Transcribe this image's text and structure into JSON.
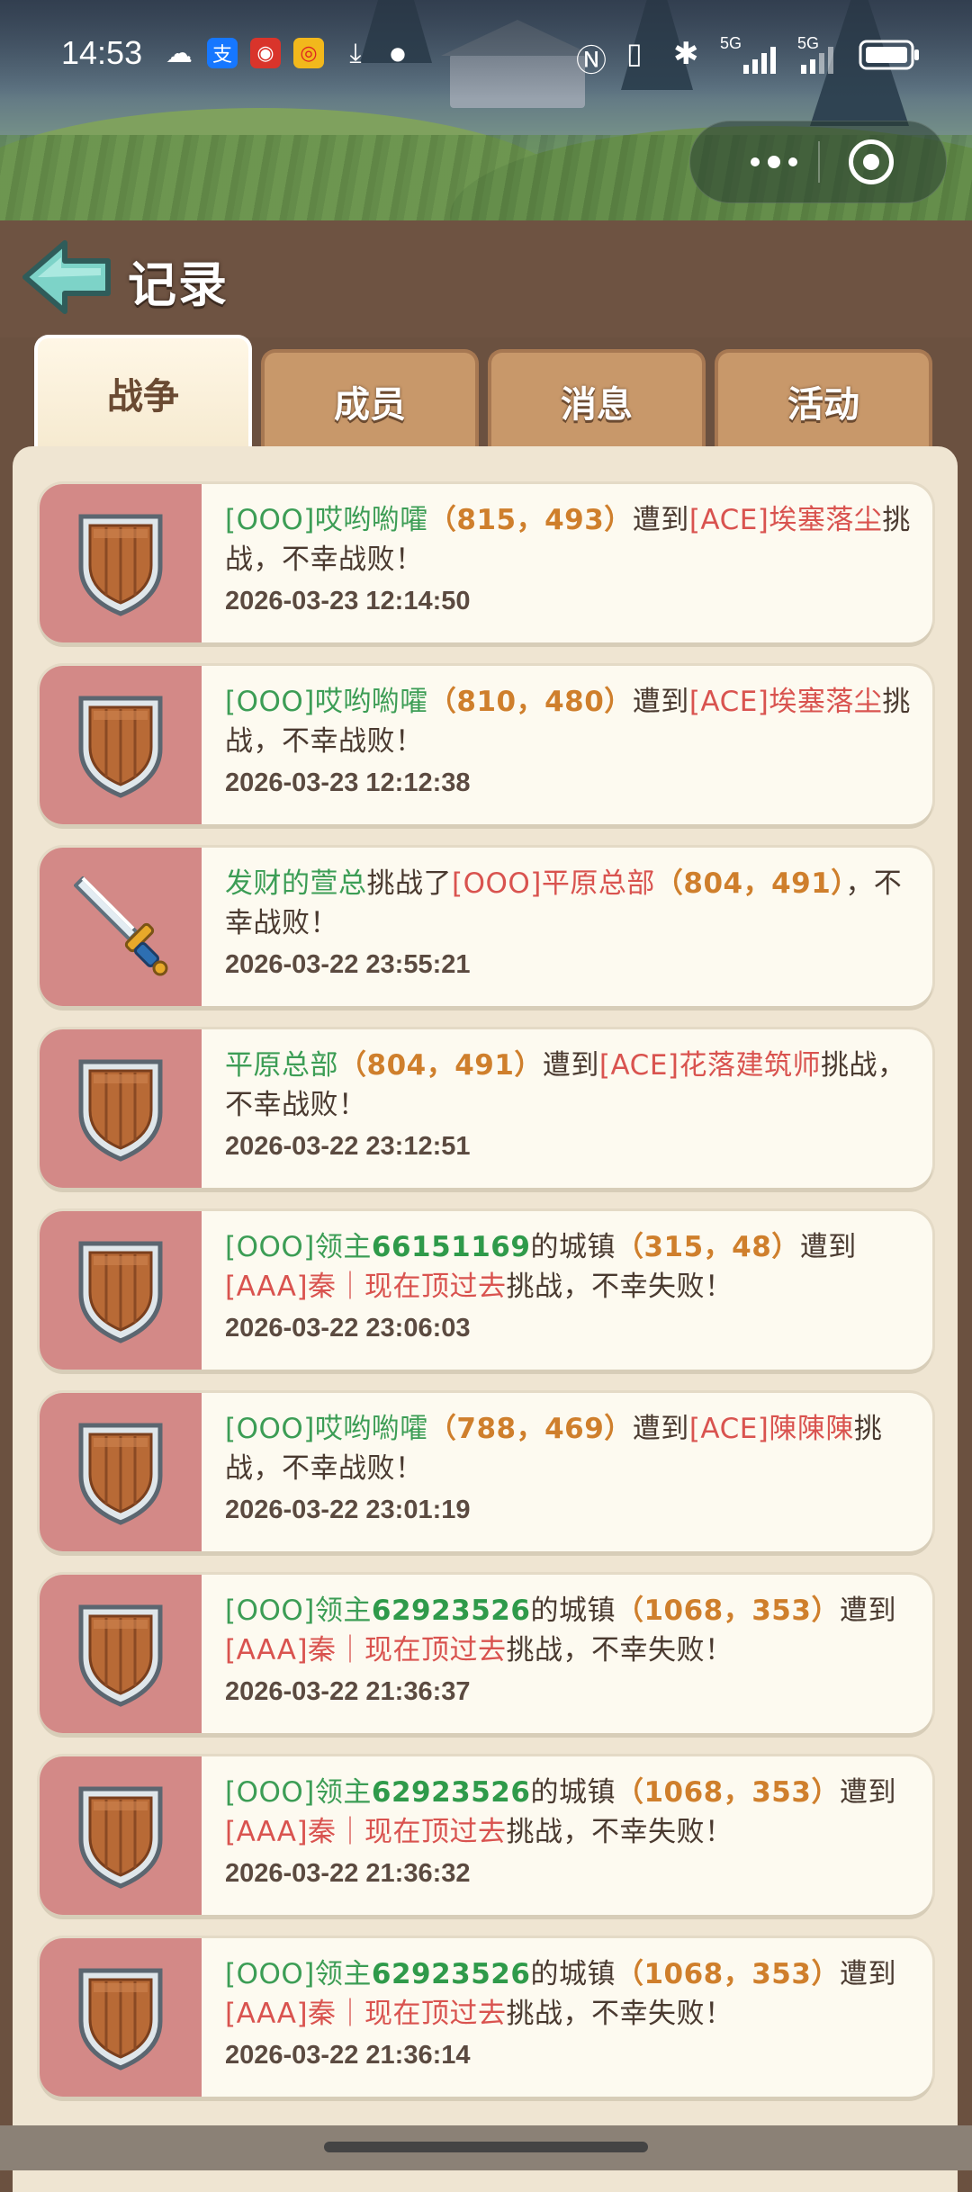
{
  "status_bar": {
    "time": "14:53",
    "network_label": "5G",
    "network_label_2": "5G"
  },
  "header": {
    "title": "记录"
  },
  "tabs": [
    {
      "label": "战争",
      "active": true
    },
    {
      "label": "成员",
      "active": false
    },
    {
      "label": "消息",
      "active": false
    },
    {
      "label": "活动",
      "active": false
    }
  ],
  "records": [
    {
      "icon": "shield-icon",
      "parts": [
        [
          "g",
          "[OOO]哎哟喲嚯"
        ],
        [
          "o",
          "（815，493）"
        ],
        [
          "n",
          "遭到"
        ],
        [
          "r",
          "[ACE]埃塞落尘"
        ],
        [
          "n",
          "挑战，不幸战败！"
        ]
      ],
      "time": "2026-03-23 12:14:50"
    },
    {
      "icon": "shield-icon",
      "parts": [
        [
          "g",
          "[OOO]哎哟喲嚯"
        ],
        [
          "o",
          "（810，480）"
        ],
        [
          "n",
          "遭到"
        ],
        [
          "r",
          "[ACE]埃塞落尘"
        ],
        [
          "n",
          "挑战，不幸战败！"
        ]
      ],
      "time": "2026-03-23 12:12:38"
    },
    {
      "icon": "sword-icon",
      "parts": [
        [
          "g",
          "发财的萱总"
        ],
        [
          "n",
          "挑战了"
        ],
        [
          "r",
          "[OOO]平原总部"
        ],
        [
          "o",
          "（804，491）"
        ],
        [
          "n",
          "，不幸战败！"
        ]
      ],
      "time": "2026-03-22 23:55:21"
    },
    {
      "icon": "shield-icon",
      "parts": [
        [
          "g",
          "平原总部"
        ],
        [
          "o",
          "（804，491）"
        ],
        [
          "n",
          "遭到"
        ],
        [
          "r",
          "[ACE]花落建筑师"
        ],
        [
          "n",
          "挑战，不幸战败！"
        ]
      ],
      "time": "2026-03-22 23:12:51"
    },
    {
      "icon": "shield-icon",
      "parts": [
        [
          "g",
          "[OOO]领主"
        ],
        [
          "gb",
          "66151169"
        ],
        [
          "n",
          "的城镇"
        ],
        [
          "o",
          "（315，48）"
        ],
        [
          "n",
          "遭到"
        ],
        [
          "r",
          "[AAA]秦｜现在顶过去"
        ],
        [
          "n",
          "挑战，不幸失败！"
        ]
      ],
      "time": "2026-03-22 23:06:03"
    },
    {
      "icon": "shield-icon",
      "parts": [
        [
          "g",
          "[OOO]哎哟喲嚯"
        ],
        [
          "o",
          "（788，469）"
        ],
        [
          "n",
          "遭到"
        ],
        [
          "r",
          "[ACE]陳陳陳"
        ],
        [
          "n",
          "挑战，不幸战败！"
        ]
      ],
      "time": "2026-03-22 23:01:19"
    },
    {
      "icon": "shield-icon",
      "parts": [
        [
          "g",
          "[OOO]领主"
        ],
        [
          "gb",
          "62923526"
        ],
        [
          "n",
          "的城镇"
        ],
        [
          "o",
          "（1068，353）"
        ],
        [
          "n",
          "遭到"
        ],
        [
          "r",
          "[AAA]秦｜现在顶过去"
        ],
        [
          "n",
          "挑战，不幸失败！"
        ]
      ],
      "time": "2026-03-22 21:36:37"
    },
    {
      "icon": "shield-icon",
      "parts": [
        [
          "g",
          "[OOO]领主"
        ],
        [
          "gb",
          "62923526"
        ],
        [
          "n",
          "的城镇"
        ],
        [
          "o",
          "（1068，353）"
        ],
        [
          "n",
          "遭到"
        ],
        [
          "r",
          "[AAA]秦｜现在顶过去"
        ],
        [
          "n",
          "挑战，不幸失败！"
        ]
      ],
      "time": "2026-03-22 21:36:32"
    },
    {
      "icon": "shield-icon",
      "parts": [
        [
          "g",
          "[OOO]领主"
        ],
        [
          "gb",
          "62923526"
        ],
        [
          "n",
          "的城镇"
        ],
        [
          "o",
          "（1068，353）"
        ],
        [
          "n",
          "遭到"
        ],
        [
          "r",
          "[AAA]秦｜现在顶过去"
        ],
        [
          "n",
          "挑战，不幸失败！"
        ]
      ],
      "time": "2026-03-22 21:36:14"
    }
  ],
  "colors": {
    "name_green": "#3c9d55",
    "enemy_red": "#d9534f",
    "coord_orange": "#cf7f2c",
    "icon_panel": "#d38987"
  }
}
